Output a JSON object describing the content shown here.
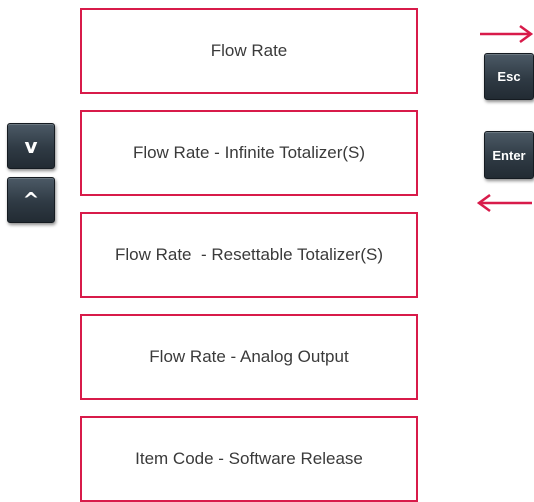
{
  "menu": {
    "items": [
      {
        "label": "Flow Rate"
      },
      {
        "label": "Flow Rate - Infinite Totalizer(S)"
      },
      {
        "label": "Flow Rate  - Resettable Totalizer(S)"
      },
      {
        "label": "Flow Rate - Analog Output"
      },
      {
        "label": "Item Code - Software Release"
      }
    ]
  },
  "keys": {
    "down": "v",
    "up": "^",
    "esc": "Esc",
    "enter": "Enter"
  },
  "colors": {
    "accent": "#d81b4a",
    "key_bg": "#2f3a44",
    "text": "#3a3a3a"
  }
}
